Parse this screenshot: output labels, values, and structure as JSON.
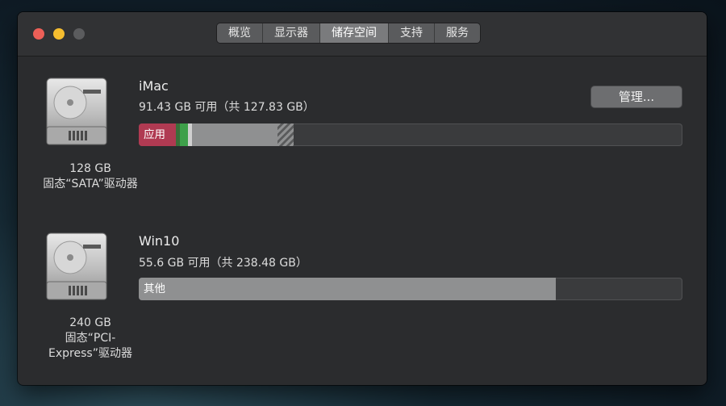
{
  "tabs": [
    {
      "label": "概览",
      "active": false
    },
    {
      "label": "显示器",
      "active": false
    },
    {
      "label": "储存空间",
      "active": true
    },
    {
      "label": "支持",
      "active": false
    },
    {
      "label": "服务",
      "active": false
    }
  ],
  "drives": [
    {
      "icon": "hard-drive-icon",
      "size_label": "128 GB",
      "type_label": "固态“SATA”驱动器",
      "volume_name": "iMac",
      "capacity_text": "91.43 GB 可用（共 127.83 GB）",
      "bar_segments": [
        {
          "label": "应用",
          "fraction": 0.068,
          "color": "#b03a52"
        },
        {
          "label": "",
          "fraction": 0.007,
          "color": "#3a6f3a"
        },
        {
          "label": "",
          "fraction": 0.016,
          "color": "#3ea04a"
        },
        {
          "label": "",
          "fraction": 0.007,
          "color": "#d0d0d0"
        },
        {
          "label": "",
          "fraction": 0.157,
          "color": "#8f9091"
        },
        {
          "label": "",
          "fraction": 0.03,
          "color": "hatch"
        }
      ]
    },
    {
      "icon": "hard-drive-icon",
      "size_label": "240 GB",
      "type_label": "固态“PCI-Express”驱动器",
      "type_label_line1": "固态“PCI-",
      "type_label_line2": "Express”驱动器",
      "volume_name": "Win10",
      "capacity_text": "55.6 GB 可用（共 238.48 GB）",
      "bar_segments": [
        {
          "label": "其他",
          "fraction": 0.767,
          "color": "#8f9091"
        }
      ]
    }
  ],
  "manage_button": {
    "label": "管理..."
  }
}
